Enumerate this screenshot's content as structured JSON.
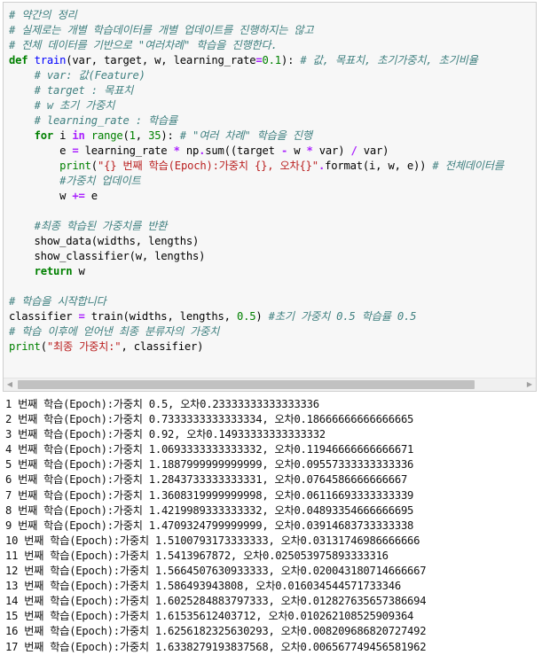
{
  "code_cell": {
    "lines": [
      [
        {
          "t": "# 약간의 정리",
          "c": "tok-comment"
        }
      ],
      [
        {
          "t": "# 실제로는 개별 학습데이터를 개별 업데이트를 진행하지는 않고",
          "c": "tok-comment"
        }
      ],
      [
        {
          "t": "# 전체 데이터를 기반으로 \"여러차례\" 학습을 진행한다.",
          "c": "tok-comment"
        }
      ],
      [
        {
          "t": "def",
          "c": "tok-kw"
        },
        {
          "t": " ",
          "c": "tok-name"
        },
        {
          "t": "train",
          "c": "tok-fn"
        },
        {
          "t": "(var, target, w, learning_rate",
          "c": "tok-name"
        },
        {
          "t": "=",
          "c": "tok-op"
        },
        {
          "t": "0.1",
          "c": "tok-num"
        },
        {
          "t": "): ",
          "c": "tok-name"
        },
        {
          "t": "# 값, 목표치, 초기가중치, 초기비율",
          "c": "tok-comment"
        }
      ],
      [
        {
          "t": "    ",
          "c": "tok-name"
        },
        {
          "t": "# var: 값(Feature)",
          "c": "tok-comment"
        }
      ],
      [
        {
          "t": "    ",
          "c": "tok-name"
        },
        {
          "t": "# target : 목표치",
          "c": "tok-comment"
        }
      ],
      [
        {
          "t": "    ",
          "c": "tok-name"
        },
        {
          "t": "# w 초기 가중치",
          "c": "tok-comment"
        }
      ],
      [
        {
          "t": "    ",
          "c": "tok-name"
        },
        {
          "t": "# learning_rate : 학습률",
          "c": "tok-comment"
        }
      ],
      [
        {
          "t": "    ",
          "c": "tok-name"
        },
        {
          "t": "for",
          "c": "tok-kw"
        },
        {
          "t": " i ",
          "c": "tok-name"
        },
        {
          "t": "in",
          "c": "tok-op"
        },
        {
          "t": " ",
          "c": "tok-name"
        },
        {
          "t": "range",
          "c": "tok-builtin"
        },
        {
          "t": "(",
          "c": "tok-name"
        },
        {
          "t": "1",
          "c": "tok-num"
        },
        {
          "t": ", ",
          "c": "tok-name"
        },
        {
          "t": "35",
          "c": "tok-num"
        },
        {
          "t": "): ",
          "c": "tok-name"
        },
        {
          "t": "# \"여러 차례\" 학습을 진행",
          "c": "tok-comment"
        }
      ],
      [
        {
          "t": "        e ",
          "c": "tok-name"
        },
        {
          "t": "=",
          "c": "tok-op"
        },
        {
          "t": " learning_rate ",
          "c": "tok-name"
        },
        {
          "t": "*",
          "c": "tok-op"
        },
        {
          "t": " np",
          "c": "tok-name"
        },
        {
          "t": ".",
          "c": "tok-op"
        },
        {
          "t": "sum((target ",
          "c": "tok-name"
        },
        {
          "t": "-",
          "c": "tok-op"
        },
        {
          "t": " w ",
          "c": "tok-name"
        },
        {
          "t": "*",
          "c": "tok-op"
        },
        {
          "t": " var) ",
          "c": "tok-name"
        },
        {
          "t": "/",
          "c": "tok-op"
        },
        {
          "t": " var)",
          "c": "tok-name"
        }
      ],
      [
        {
          "t": "        ",
          "c": "tok-name"
        },
        {
          "t": "print",
          "c": "tok-builtin"
        },
        {
          "t": "(",
          "c": "tok-name"
        },
        {
          "t": "\"{} 번째 학습(Epoch):가중치 {}, 오차{}\"",
          "c": "tok-str"
        },
        {
          "t": ".",
          "c": "tok-op"
        },
        {
          "t": "format(i, w, e)) ",
          "c": "tok-name"
        },
        {
          "t": "# 전체데이터를",
          "c": "tok-comment"
        }
      ],
      [
        {
          "t": "        ",
          "c": "tok-name"
        },
        {
          "t": "#가중치 업데이트",
          "c": "tok-comment"
        }
      ],
      [
        {
          "t": "        w ",
          "c": "tok-name"
        },
        {
          "t": "+=",
          "c": "tok-op"
        },
        {
          "t": " e",
          "c": "tok-name"
        }
      ],
      [
        {
          "t": "",
          "c": "tok-name"
        }
      ],
      [
        {
          "t": "    ",
          "c": "tok-name"
        },
        {
          "t": "#최종 학습된 가중치를 반환",
          "c": "tok-comment"
        }
      ],
      [
        {
          "t": "    show_data(widths, lengths)",
          "c": "tok-name"
        }
      ],
      [
        {
          "t": "    show_classifier(w, lengths)",
          "c": "tok-name"
        }
      ],
      [
        {
          "t": "    ",
          "c": "tok-name"
        },
        {
          "t": "return",
          "c": "tok-kw"
        },
        {
          "t": " w",
          "c": "tok-name"
        }
      ],
      [
        {
          "t": "",
          "c": "tok-name"
        }
      ],
      [
        {
          "t": "# 학습을 시작합니다",
          "c": "tok-comment"
        }
      ],
      [
        {
          "t": "classifier ",
          "c": "tok-name"
        },
        {
          "t": "=",
          "c": "tok-op"
        },
        {
          "t": " train(widths, lengths, ",
          "c": "tok-name"
        },
        {
          "t": "0.5",
          "c": "tok-num"
        },
        {
          "t": ") ",
          "c": "tok-name"
        },
        {
          "t": "#초기 가중치 0.5 학습률 0.5",
          "c": "tok-comment"
        }
      ],
      [
        {
          "t": "# 학습 이후에 얻어낸 최종 분류자의 가중치",
          "c": "tok-comment"
        }
      ],
      [
        {
          "t": "print",
          "c": "tok-builtin"
        },
        {
          "t": "(",
          "c": "tok-name"
        },
        {
          "t": "\"최종 가중치:\"",
          "c": "tok-str"
        },
        {
          "t": ", classifier)",
          "c": "tok-name"
        }
      ]
    ],
    "scrollbar": {
      "left_arrow": "◀",
      "right_arrow": "▶"
    }
  },
  "output": {
    "lines": [
      "1 번째 학습(Epoch):가중치 0.5, 오차0.23333333333333336",
      "2 번째 학습(Epoch):가중치 0.7333333333333334, 오차0.18666666666666665",
      "3 번째 학습(Epoch):가중치 0.92, 오차0.14933333333333332",
      "4 번째 학습(Epoch):가중치 1.0693333333333332, 오차0.11946666666666671",
      "5 번째 학습(Epoch):가중치 1.1887999999999999, 오차0.09557333333333336",
      "6 번째 학습(Epoch):가중치 1.2843733333333331, 오차0.0764586666666667",
      "7 번째 학습(Epoch):가중치 1.3608319999999998, 오차0.06116693333333339",
      "8 번째 학습(Epoch):가중치 1.4219989333333332, 오차0.04893354666666695",
      "9 번째 학습(Epoch):가중치 1.4709324799999999, 오차0.03914683733333338",
      "10 번째 학습(Epoch):가중치 1.5100793173333333, 오차0.03131746986666666",
      "11 번째 학습(Epoch):가중치 1.5413967872, 오차0.025053975893333316",
      "12 번째 학습(Epoch):가중치 1.5664507630933333, 오차0.020043180714666667",
      "13 번째 학습(Epoch):가중치 1.586493943808, 오차0.016034544571733346",
      "14 번째 학습(Epoch):가중치 1.6025284883797333, 오차0.012827635657386694",
      "15 번째 학습(Epoch):가중치 1.61535612403712, 오차0.010262108525909364",
      "16 번째 학습(Epoch):가중치 1.6256182325630293, 오차0.008209686820727492",
      "17 번째 학습(Epoch):가중치 1.6338279193837568, 오차0.006567749456581962"
    ]
  }
}
